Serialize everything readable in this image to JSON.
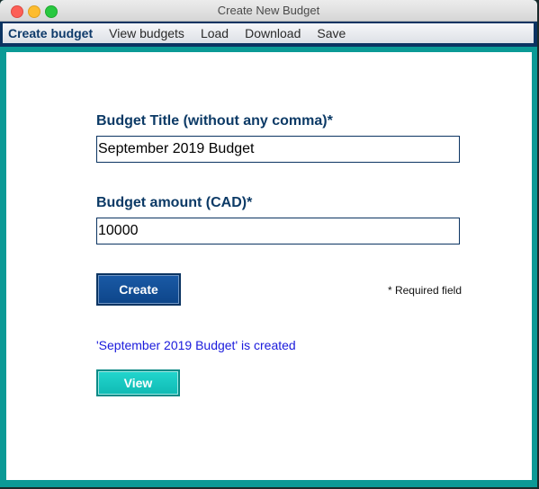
{
  "window": {
    "title": "Create New Budget"
  },
  "menu": {
    "items": [
      {
        "label": "Create budget",
        "active": true
      },
      {
        "label": "View budgets",
        "active": false
      },
      {
        "label": "Load",
        "active": false
      },
      {
        "label": "Download",
        "active": false
      },
      {
        "label": "Save",
        "active": false
      }
    ]
  },
  "form": {
    "title_label": "Budget Title (without any comma)*",
    "title_value": "September 2019 Budget",
    "amount_label": "Budget amount (CAD)*",
    "amount_value": "10000",
    "create_label": "Create",
    "required_note": "* Required field",
    "status_message": "'September 2019 Budget' is created",
    "view_label": "View"
  },
  "colors": {
    "accent_dark": "#0b3462",
    "accent_teal": "#0b9a96",
    "status_text": "#1a1adc"
  }
}
